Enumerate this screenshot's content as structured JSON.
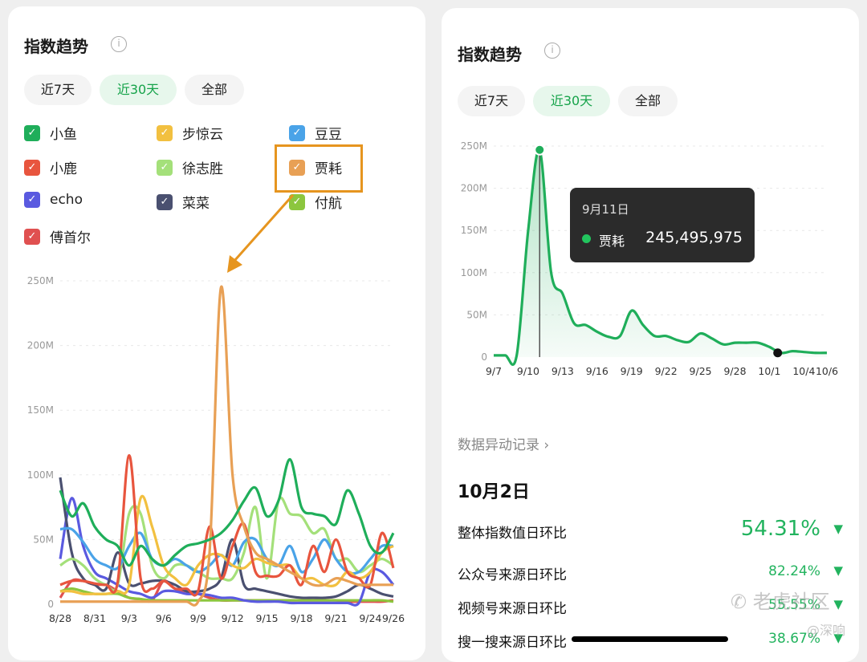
{
  "left": {
    "title": "指数趋势",
    "info_icon": "i",
    "tabs": [
      {
        "label": "近7天"
      },
      {
        "label": "近30天",
        "active": true
      },
      {
        "label": "全部"
      }
    ],
    "legend": [
      {
        "name": "小鱼",
        "color": "#1fae5a"
      },
      {
        "name": "步惊云",
        "color": "#f2c040"
      },
      {
        "name": "豆豆",
        "color": "#4aa3e8"
      },
      {
        "name": "小鹿",
        "color": "#e8553e"
      },
      {
        "name": "徐志胜",
        "color": "#a4e07a"
      },
      {
        "name": "贾耗",
        "color": "#e8a055"
      },
      {
        "name": "echo",
        "color": "#5a5ae0"
      },
      {
        "name": "菜菜",
        "color": "#4a5070"
      },
      {
        "name": "付航",
        "color": "#8cc63e"
      },
      {
        "name": "傅首尔",
        "color": "#e05050"
      }
    ],
    "highlight_color": "#e6951f"
  },
  "right": {
    "title": "指数趋势",
    "info_icon": "i",
    "tabs": [
      {
        "label": "近7天"
      },
      {
        "label": "近30天",
        "active": true
      },
      {
        "label": "全部"
      }
    ],
    "tooltip": {
      "date": "9月11日",
      "series": "贾耗",
      "value": "245,495,975"
    },
    "anomaly_link": "数据异动记录",
    "date": "10月2日",
    "metrics": [
      {
        "label": "整体指数值日环比",
        "value": "54.31%",
        "trend": "down"
      },
      {
        "label": "公众号来源日环比",
        "value": "82.24%",
        "trend": "down"
      },
      {
        "label": "视频号来源日环比",
        "value": "55.55%",
        "trend": "down"
      },
      {
        "label": "搜一搜来源日环比",
        "value": "38.67%",
        "trend": "down"
      }
    ],
    "watermark": "老虎社区",
    "watermark2": "@深响"
  },
  "chart_data": [
    {
      "type": "line",
      "ylim": [
        0,
        250
      ],
      "yticks": [
        "0",
        "50M",
        "100M",
        "150M",
        "200M",
        "250M"
      ],
      "xticks": [
        "8/28",
        "8/31",
        "9/3",
        "9/6",
        "9/9",
        "9/12",
        "9/15",
        "9/18",
        "9/21",
        "9/24",
        "9/26"
      ],
      "x_start": "8/28",
      "x_end": "9/26",
      "unit": "M",
      "grid": true,
      "series": [
        {
          "name": "傅首尔",
          "color": "#e05050",
          "values": [
            5,
            18,
            18,
            15,
            15,
            10,
            5,
            4,
            3,
            18,
            12,
            10,
            8,
            5,
            3,
            3,
            3,
            3,
            3,
            3,
            3,
            3,
            3,
            3,
            3,
            2,
            2,
            2,
            2,
            3
          ]
        },
        {
          "name": "付航",
          "color": "#8cc63e",
          "values": [
            10,
            12,
            10,
            8,
            8,
            8,
            5,
            4,
            3,
            3,
            3,
            3,
            3,
            3,
            3,
            3,
            3,
            3,
            3,
            3,
            3,
            3,
            3,
            3,
            3,
            3,
            3,
            3,
            3,
            2
          ]
        },
        {
          "name": "echo",
          "color": "#5a5ae0",
          "values": [
            35,
            82,
            45,
            25,
            20,
            15,
            10,
            8,
            5,
            10,
            10,
            8,
            8,
            7,
            5,
            5,
            3,
            2,
            2,
            2,
            1,
            1,
            1,
            1,
            1,
            1,
            1,
            25,
            25,
            15
          ]
        },
        {
          "name": "菜菜",
          "color": "#4a5070",
          "values": [
            98,
            40,
            20,
            15,
            12,
            40,
            16,
            16,
            18,
            18,
            15,
            10,
            10,
            12,
            20,
            50,
            15,
            12,
            10,
            8,
            6,
            5,
            5,
            5,
            6,
            10,
            15,
            12,
            8,
            6
          ]
        },
        {
          "name": "徐志胜",
          "color": "#a4e07a",
          "values": [
            30,
            35,
            30,
            20,
            15,
            15,
            70,
            70,
            30,
            20,
            30,
            30,
            25,
            20,
            20,
            20,
            40,
            75,
            20,
            80,
            70,
            68,
            55,
            58,
            35,
            35,
            25,
            30,
            35,
            30
          ]
        },
        {
          "name": "豆豆",
          "color": "#4aa3e8",
          "values": [
            58,
            58,
            48,
            35,
            30,
            28,
            45,
            55,
            35,
            30,
            35,
            30,
            25,
            30,
            38,
            30,
            48,
            50,
            35,
            30,
            45,
            25,
            35,
            50,
            35,
            25,
            25,
            35,
            45,
            45
          ]
        },
        {
          "name": "步惊云",
          "color": "#f2c040",
          "values": [
            10,
            10,
            8,
            8,
            8,
            10,
            15,
            82,
            60,
            30,
            20,
            15,
            30,
            38,
            38,
            30,
            28,
            35,
            32,
            30,
            30,
            20,
            20,
            15,
            15,
            25,
            20,
            25,
            40,
            45
          ]
        },
        {
          "name": "小鹿",
          "color": "#e8553e",
          "values": [
            15,
            18,
            18,
            16,
            15,
            17,
            115,
            20,
            12,
            18,
            12,
            12,
            10,
            60,
            20,
            45,
            62,
            25,
            22,
            22,
            30,
            15,
            45,
            25,
            50,
            25,
            20,
            15,
            55,
            28
          ]
        },
        {
          "name": "贾耗",
          "color": "#e8a055",
          "values": [
            2,
            2,
            2,
            2,
            2,
            2,
            2,
            2,
            2,
            2,
            2,
            2,
            2,
            40,
            245,
            100,
            60,
            40,
            35,
            30,
            25,
            20,
            15,
            15,
            20,
            18,
            15,
            15,
            15,
            15
          ]
        },
        {
          "name": "小鱼",
          "color": "#1fae5a",
          "values": [
            88,
            68,
            78,
            60,
            50,
            45,
            30,
            45,
            35,
            30,
            38,
            45,
            47,
            50,
            55,
            65,
            80,
            90,
            68,
            80,
            112,
            75,
            70,
            68,
            62,
            88,
            70,
            45,
            40,
            55
          ]
        }
      ]
    },
    {
      "type": "area",
      "ylim": [
        0,
        250
      ],
      "yticks": [
        "0",
        "50M",
        "100M",
        "150M",
        "200M",
        "250M"
      ],
      "xticks": [
        "9/7",
        "9/10",
        "9/13",
        "9/16",
        "9/19",
        "9/22",
        "9/25",
        "9/28",
        "10/1",
        "10/4",
        "10/6"
      ],
      "x_start": "9/7",
      "x_end": "10/6",
      "unit": "M",
      "grid": true,
      "series": [
        {
          "name": "贾耗",
          "color": "#1fae5a",
          "values": [
            2,
            2,
            2,
            150,
            245,
            100,
            75,
            40,
            38,
            30,
            24,
            25,
            55,
            38,
            25,
            25,
            20,
            18,
            28,
            22,
            15,
            17,
            17,
            17,
            12,
            5,
            7,
            6,
            5,
            5
          ]
        }
      ],
      "highlight": {
        "x": "9/11",
        "value": 245495975
      },
      "marker": {
        "x": "10/2"
      }
    }
  ]
}
